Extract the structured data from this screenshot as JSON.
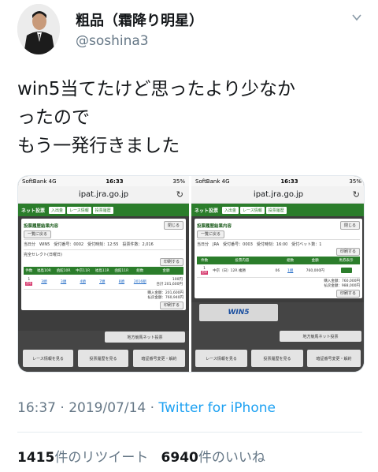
{
  "user": {
    "display_name": "粗品（霜降り明星）",
    "handle": "@soshina3"
  },
  "tweet": {
    "lines": [
      "win5当てたけど思ったより少なか",
      "ったので",
      "もう一発行きました"
    ],
    "time": "16:37",
    "date": "2019/07/14",
    "separator": "·",
    "source": "Twitter for iPhone"
  },
  "stats": {
    "retweets": "1415",
    "retweets_label": "件のリツイート",
    "likes": "6940",
    "likes_label": "件のいいね"
  },
  "screenshots": [
    {
      "status": {
        "carrier": "SoftBank 4G",
        "time": "16:33",
        "battery": "35%"
      },
      "url": "ipat.jra.go.jp",
      "nav": {
        "logo": "ネット投票",
        "tabs": [
          "入出金",
          "レース情報",
          "投票履歴"
        ]
      },
      "panel_title": "投票履歴結果内容",
      "back_button": "一覧に戻る",
      "close_button": "閉じる",
      "info_line": "当日分　WIN5　受付番号：0002　受付時刻：12:55　投票件数：2,016",
      "select_line": "完全セレクト(日曜日)",
      "print_button": "印刷する",
      "table_headers": [
        "件数",
        "福島10R",
        "函館10R",
        "中京11R",
        "福島11R",
        "函館11R",
        "組数",
        "金額"
      ],
      "table_row": {
        "num": "1",
        "c1": "3頭",
        "c2": "3頭",
        "c3": "4頭",
        "c4": "7頭",
        "c5": "8頭",
        "kumi": "2016組",
        "amount": "100円",
        "total_label": "合計",
        "total": "201,600円"
      },
      "summary": [
        "購入金額：201,600円",
        "払戻金額：760,940円"
      ],
      "bottom_banner": "地方競馬ネット投票",
      "bottom_buttons": [
        "レース情報を見る",
        "投票履歴を見る",
        "暗証番号変更・解約"
      ]
    },
    {
      "status": {
        "carrier": "SoftBank 4G",
        "time": "16:33",
        "battery": "35%"
      },
      "url": "ipat.jra.go.jp",
      "nav": {
        "logo": "ネット投票",
        "tabs": [
          "入出金",
          "レース情報",
          "投票履歴"
        ]
      },
      "panel_title": "投票履歴結果内容",
      "back_button": "一覧に戻る",
      "close_button": "閉じる",
      "info_line": "当日分　JRA　受付番号：0003　受付時刻：16:00　受付ベット数：1",
      "print_button": "印刷する",
      "table_headers": [
        "件数",
        "投票内容",
        "",
        "組数",
        "金額",
        "馬券表示"
      ],
      "table_row": {
        "num": "1",
        "race": "中京（日）12R 複勝",
        "horse": "06",
        "kumi": "1組",
        "amount": "760,000円"
      },
      "summary": [
        "購入金額：760,000円",
        "払戻金額：988,000円"
      ],
      "win5": "WIN5",
      "bottom_banner": "地方競馬ネット投票",
      "bottom_buttons": [
        "レース情報を見る",
        "投票履歴を見る",
        "暗証番号変更・解約"
      ]
    }
  ]
}
